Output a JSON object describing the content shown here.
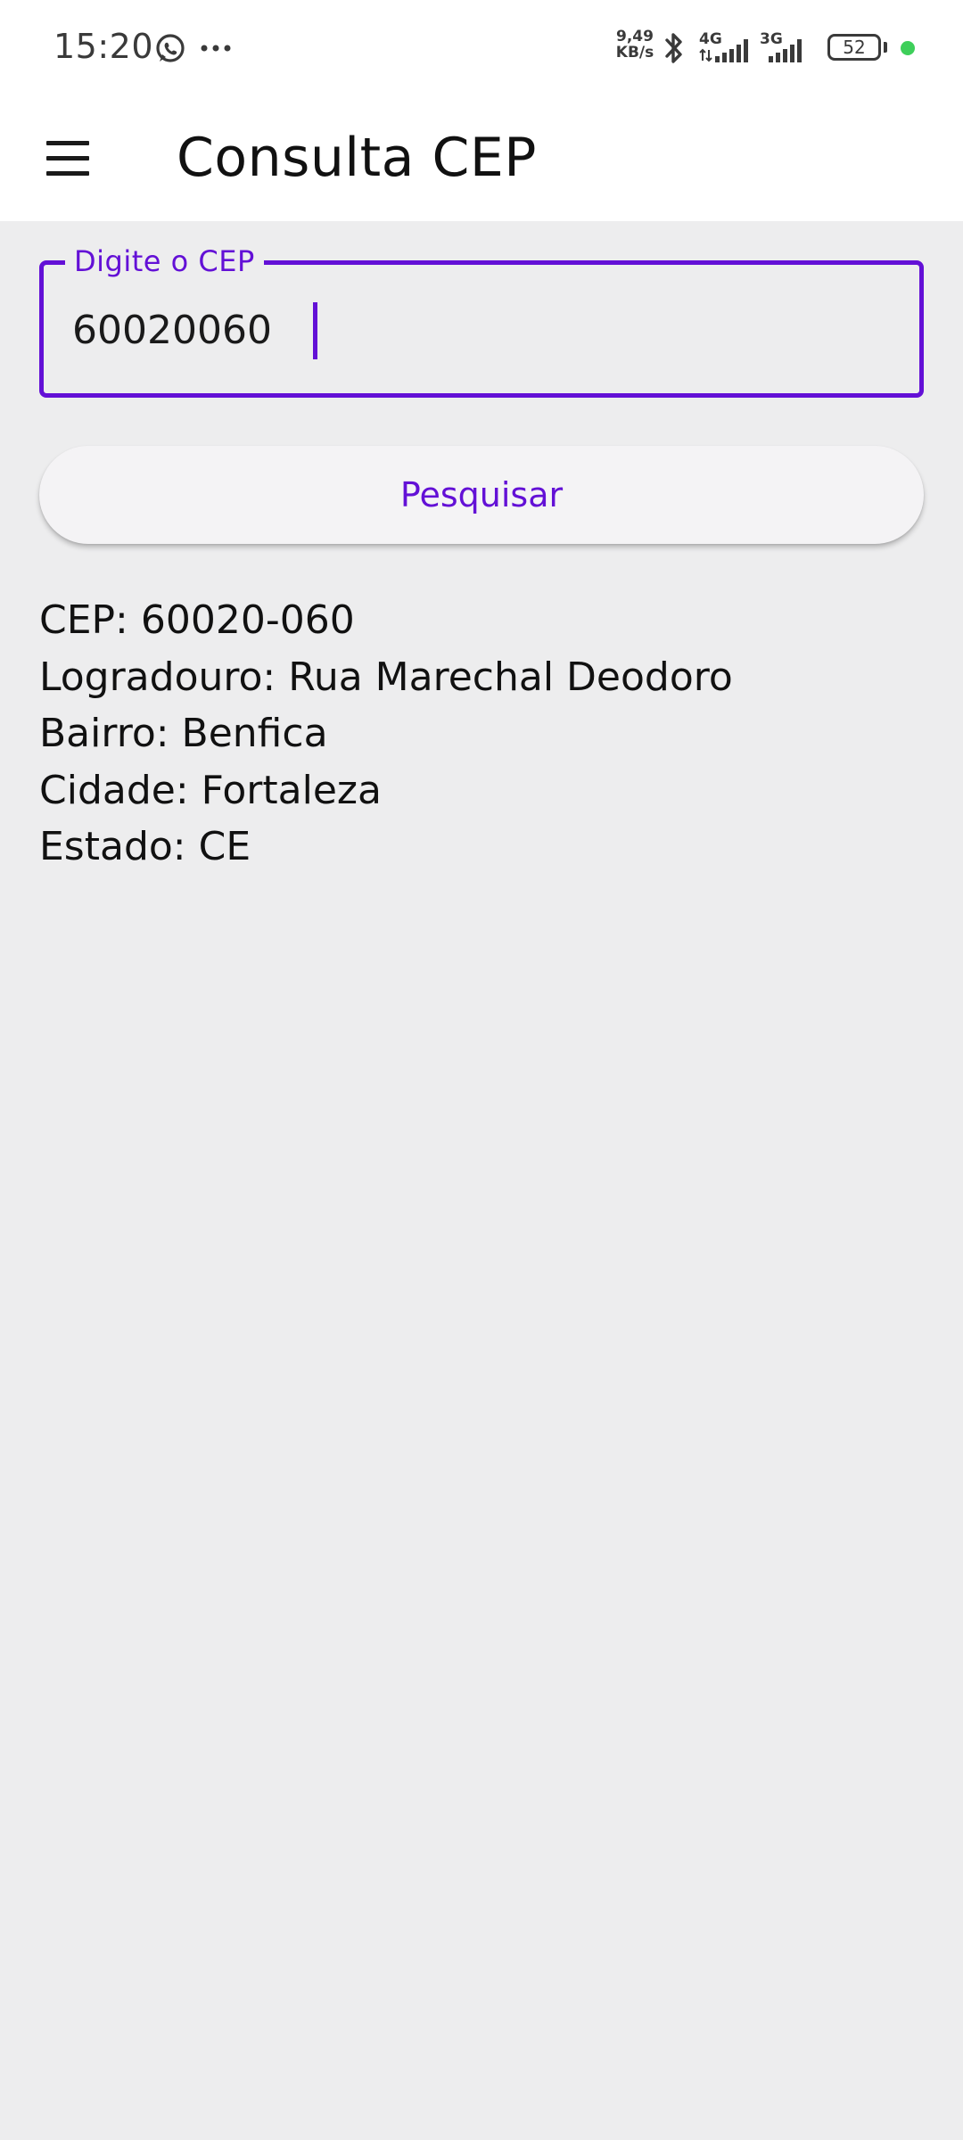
{
  "status_bar": {
    "time": "15:20",
    "net_speed_value": "9,49",
    "net_speed_unit": "KB/s",
    "network_1": "4G",
    "network_2": "3G",
    "battery_level": "52",
    "icons": [
      "whatsapp-icon",
      "more-dots-icon",
      "bluetooth-icon",
      "signal-icon",
      "battery-icon"
    ]
  },
  "app_bar": {
    "title": "Consulta CEP",
    "menu_icon": "hamburger-menu-icon"
  },
  "form": {
    "cep_label": "Digite o CEP",
    "cep_value": "60020060",
    "search_label": "Pesquisar"
  },
  "result": {
    "cep": "CEP: 60020-060",
    "logradouro": "Logradouro: Rua Marechal Deodoro",
    "bairro": "Bairro: Benfica",
    "cidade": "Cidade: Fortaleza",
    "estado": "Estado: CE"
  },
  "colors": {
    "accent": "#6310d6",
    "background": "#ededee",
    "app_bar": "#ffffff",
    "status_dot": "#3ecf5a"
  }
}
